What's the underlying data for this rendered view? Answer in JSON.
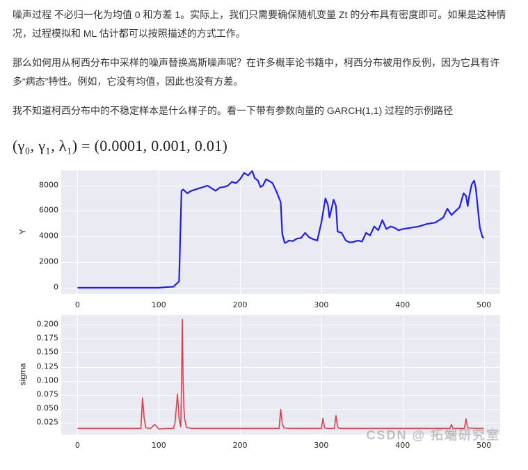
{
  "paragraphs": {
    "p1": "噪声过程 不必归一化为均值 0 和方差 1。实际上，我们只需要确保随机变量 Zt 的分布具有密度即可。如果是这种情况，过程模拟和 ML 估计都可以按照描述的方式工作。",
    "p2": "那么如何用从柯西分布中采样的噪声替换高斯噪声呢？在许多概率论书籍中，柯西分布被用作反例，因为它具有许多“病态”特性。例如，它没有均值，因此也没有方差。",
    "p3": "我不知道柯西分布中的不稳定样本是什么样子的。看一下带有参数向量的 GARCH(1,1) 过程的示例路径"
  },
  "formula": "(γ₀, γ₁, λ₁) = (0.0001, 0.001, 0.01)",
  "chart_data": [
    {
      "type": "line",
      "ylabel": "Y",
      "xlim": [
        -20,
        520
      ],
      "ylim": [
        -500,
        9200
      ],
      "yticks": [
        0,
        2000,
        4000,
        6000,
        8000
      ],
      "xticks": [
        0,
        100,
        200,
        300,
        400,
        500
      ],
      "color": "#1c1cff",
      "x": [
        0,
        10,
        20,
        30,
        40,
        50,
        60,
        70,
        80,
        90,
        100,
        110,
        118,
        120,
        125,
        128,
        130,
        135,
        140,
        150,
        160,
        170,
        175,
        180,
        185,
        190,
        195,
        200,
        205,
        210,
        215,
        218,
        222,
        225,
        228,
        232,
        235,
        240,
        245,
        250,
        252,
        255,
        258,
        260,
        265,
        270,
        275,
        280,
        285,
        290,
        295,
        300,
        305,
        308,
        310,
        315,
        318,
        320,
        325,
        330,
        335,
        340,
        345,
        350,
        355,
        360,
        365,
        370,
        375,
        380,
        385,
        390,
        395,
        400,
        410,
        420,
        430,
        440,
        450,
        455,
        460,
        465,
        470,
        475,
        478,
        480,
        482,
        485,
        488,
        490,
        495,
        498,
        500
      ],
      "y": [
        0,
        0,
        0,
        0,
        0,
        0,
        0,
        0,
        0,
        0,
        0,
        50,
        80,
        200,
        500,
        7600,
        7700,
        7400,
        7600,
        7800,
        8000,
        7600,
        7850,
        7900,
        8000,
        8300,
        8200,
        8500,
        9000,
        8800,
        9150,
        8600,
        8400,
        7900,
        8000,
        8500,
        8400,
        8200,
        7500,
        6700,
        4200,
        3500,
        3600,
        3700,
        3650,
        3850,
        3900,
        4300,
        3950,
        3800,
        3700,
        5100,
        7000,
        6500,
        5500,
        6900,
        6400,
        4400,
        4300,
        3700,
        3550,
        3600,
        3700,
        3620,
        4300,
        4100,
        4800,
        4500,
        5300,
        4600,
        4800,
        4700,
        4500,
        4600,
        4700,
        4800,
        5000,
        5100,
        5500,
        6200,
        5700,
        6000,
        6300,
        7400,
        7200,
        6400,
        7200,
        8100,
        8400,
        7800,
        4700,
        4000,
        3900
      ]
    },
    {
      "type": "line",
      "ylabel": "sigma",
      "xlim": [
        -20,
        520
      ],
      "ylim": [
        0.004,
        0.218
      ],
      "yticks": [
        0.025,
        0.05,
        0.075,
        0.1,
        0.125,
        0.15,
        0.175,
        0.2
      ],
      "xticks": [
        0,
        100,
        200,
        300,
        400,
        500
      ],
      "color": "#e23b4a",
      "x": [
        0,
        10,
        20,
        30,
        40,
        50,
        60,
        70,
        78,
        80,
        82,
        84,
        90,
        95,
        100,
        110,
        118,
        120,
        123,
        125,
        127,
        128,
        129,
        130,
        131,
        132,
        134,
        140,
        150,
        160,
        170,
        180,
        190,
        200,
        210,
        220,
        230,
        240,
        248,
        250,
        252,
        254,
        260,
        270,
        280,
        290,
        300,
        302,
        304,
        306,
        310,
        316,
        318,
        320,
        322,
        330,
        340,
        350,
        360,
        370,
        380,
        390,
        400,
        410,
        420,
        430,
        440,
        450,
        458,
        460,
        462,
        470,
        476,
        478,
        480,
        490,
        500
      ],
      "y": [
        0.015,
        0.015,
        0.015,
        0.015,
        0.015,
        0.015,
        0.015,
        0.015,
        0.015,
        0.07,
        0.034,
        0.016,
        0.015,
        0.022,
        0.014,
        0.015,
        0.015,
        0.025,
        0.076,
        0.033,
        0.018,
        0.09,
        0.21,
        0.095,
        0.05,
        0.031,
        0.017,
        0.015,
        0.015,
        0.015,
        0.015,
        0.015,
        0.015,
        0.015,
        0.015,
        0.015,
        0.015,
        0.015,
        0.015,
        0.049,
        0.023,
        0.016,
        0.015,
        0.015,
        0.015,
        0.015,
        0.015,
        0.033,
        0.016,
        0.015,
        0.015,
        0.015,
        0.038,
        0.018,
        0.015,
        0.015,
        0.015,
        0.015,
        0.015,
        0.015,
        0.015,
        0.015,
        0.015,
        0.015,
        0.015,
        0.015,
        0.015,
        0.015,
        0.015,
        0.022,
        0.015,
        0.015,
        0.015,
        0.032,
        0.016,
        0.015,
        0.015
      ]
    }
  ],
  "watermark": "CSDN @ 拓端研究室"
}
